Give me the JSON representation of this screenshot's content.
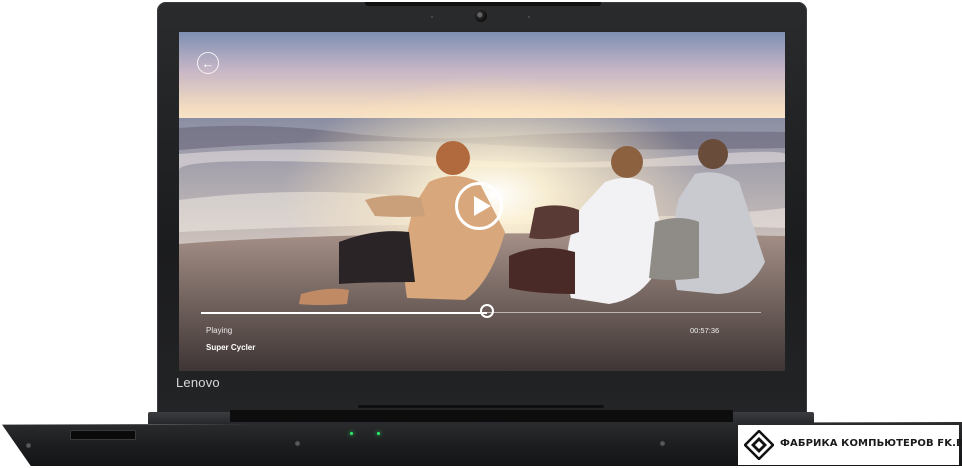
{
  "device": {
    "brand_label": "Lenovo"
  },
  "video_player": {
    "status_label": "Playing",
    "track_title": "Super Cycler",
    "time_readout": "00:57:36",
    "progress_fraction": 0.51,
    "back_icon": "back-arrow-icon",
    "play_icon": "play-icon"
  },
  "store_badge": {
    "text": "ФАБРИКА КОМПЬЮТЕРОВ FK.BY",
    "logo_icon": "diamond-logo-icon"
  },
  "colors": {
    "led": "#2cf06a",
    "bezel": "#1b1c1e"
  }
}
